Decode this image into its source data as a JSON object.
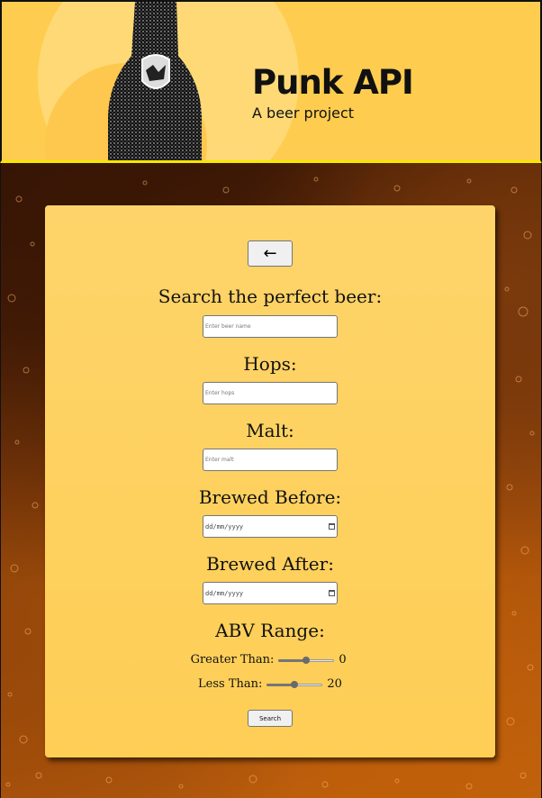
{
  "header": {
    "title": "Punk API",
    "subtitle": "A beer project"
  },
  "form": {
    "back_label": "←",
    "search_label": "Search the perfect beer:",
    "search_placeholder": "Enter beer name",
    "hops_label": "Hops:",
    "hops_placeholder": "Enter hops",
    "malt_label": "Malt:",
    "malt_placeholder": "Enter malt",
    "brewed_before_label": "Brewed Before:",
    "brewed_before_placeholder": "dd/mm/yyyy",
    "brewed_after_label": "Brewed After:",
    "brewed_after_placeholder": "dd/mm/yyyy",
    "abv_label": "ABV Range:",
    "greater_than_label": "Greater Than:",
    "greater_than_value": "0",
    "greater_than_fraction": 0.5,
    "less_than_label": "Less Than:",
    "less_than_value": "20",
    "less_than_fraction": 0.5,
    "search_button": "Search"
  },
  "colors": {
    "header_bg": "#fecd4f",
    "card_bg": "#fed46a",
    "header_border": "#f5e800"
  },
  "icons": {
    "back": "left-arrow-icon",
    "date": "calendar-icon",
    "logo": "beer-bottle-logo"
  }
}
